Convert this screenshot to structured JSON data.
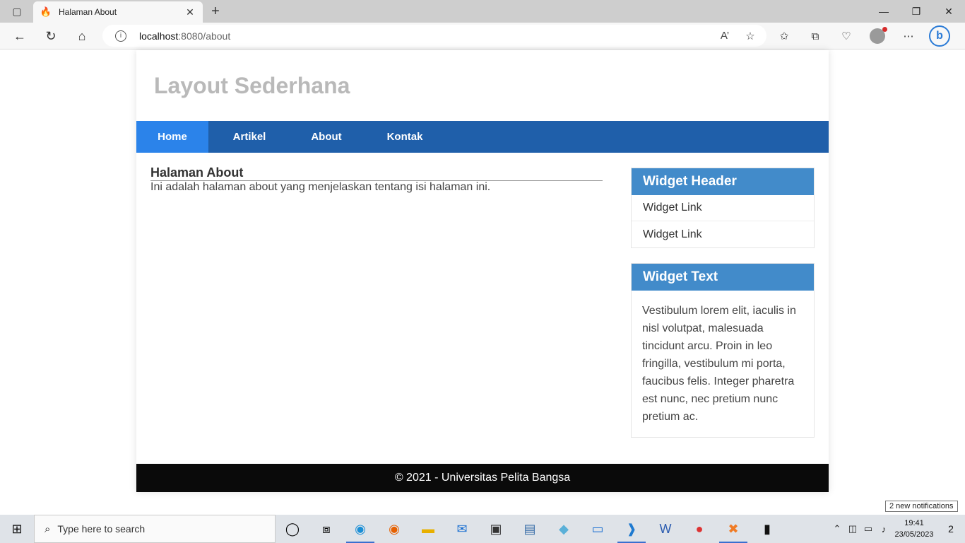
{
  "browser": {
    "tab_title": "Halaman About",
    "url_host": "localhost",
    "url_path": ":8080/about",
    "read_aloud_glyph": "A’"
  },
  "site": {
    "title": "Layout Sederhana",
    "nav": [
      {
        "label": "Home",
        "active": true
      },
      {
        "label": "Artikel",
        "active": false
      },
      {
        "label": "About",
        "active": false
      },
      {
        "label": "Kontak",
        "active": false
      }
    ],
    "main": {
      "heading": "Halaman About",
      "text": "Ini adalah halaman about yang menjelaskan tentang isi halaman ini."
    },
    "widgets": {
      "links": {
        "header": "Widget Header",
        "items": [
          "Widget Link",
          "Widget Link"
        ]
      },
      "text": {
        "header": "Widget Text",
        "body": "Vestibulum lorem elit, iaculis in nisl volutpat, malesuada tincidunt arcu. Proin in leo fringilla, vestibulum mi porta, faucibus felis. Integer pharetra est nunc, nec pretium nunc pretium ac."
      }
    },
    "footer": "© 2021 - Universitas Pelita Bangsa"
  },
  "notification_tip": "2 new notifications",
  "taskbar": {
    "search_placeholder": "Type here to search",
    "time": "19:41",
    "date": "23/05/2023",
    "notification_count": "2"
  },
  "colors": {
    "navbar": "#1f5faa",
    "nav_active": "#2b83ea",
    "widget_header": "#428bca",
    "footer": "#0a0a0a",
    "site_title": "#b9b9b9"
  }
}
